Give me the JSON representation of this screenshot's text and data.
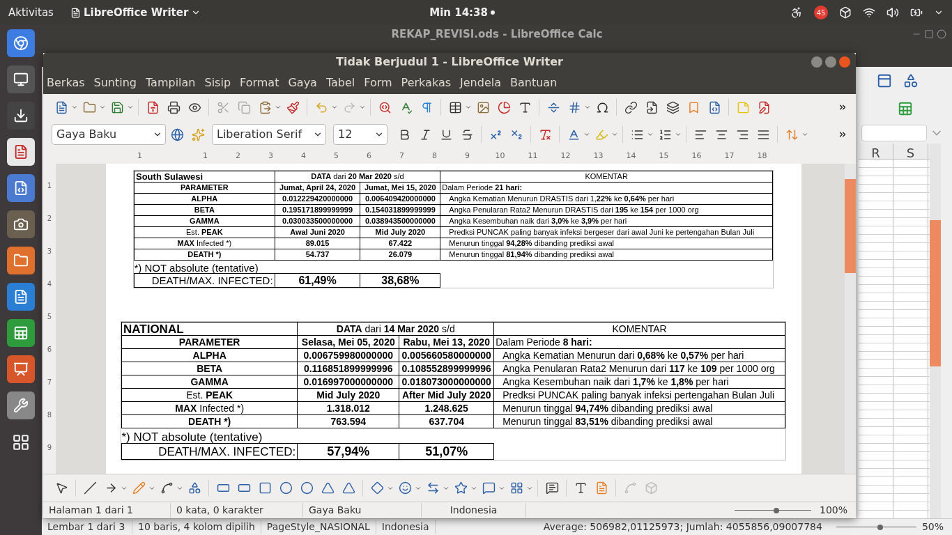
{
  "topbar": {
    "activities": "Aktivitas",
    "app_menu": "LibreOffice Writer",
    "clock": "Min 14:38",
    "notification_badge": "45"
  },
  "calc": {
    "title": "REKAP_REVISI.ods - LibreOffice Calc",
    "columns": [
      "R",
      "S"
    ],
    "status_bar": [
      "Lembar 1 dari 3",
      "10 baris, 4 kolom dipilih",
      "PageStyle_NASIONAL",
      "Indonesia",
      "Average: 506982,01125973; Jumlah: 4055856,09007784",
      "50%"
    ],
    "zoom_slider": {
      "level": 0.55
    }
  },
  "writer": {
    "title": "Tidak Berjudul 1 - LibreOffice Writer",
    "menu": [
      "Berkas",
      "Sunting",
      "Tampilan",
      "Sisip",
      "Format",
      "Gaya",
      "Tabel",
      "Form",
      "Perkakas",
      "Jendela",
      "Bantuan"
    ],
    "style_box": "Gaya Baku",
    "font_box": "Liberation Serif",
    "size_box": "12",
    "ruler_marks": [
      "1",
      "1",
      "2",
      "3",
      "4",
      "5",
      "6",
      "7",
      "8",
      "9",
      "10",
      "11",
      "12",
      "13",
      "14",
      "15",
      "16",
      "17",
      "18"
    ],
    "vertical_ruler_marks": [
      "1",
      "2",
      "3",
      "4",
      "5",
      "6",
      "7",
      "8",
      "9"
    ],
    "tables": [
      {
        "title": "South Sulawesi",
        "data_header": "**DATA** dari **20 Mar 2020** s/d",
        "comment_header": "KOMENTAR",
        "rows": [
          {
            "kind": "header",
            "param": "PARAMETER",
            "v1": "Jumat, April 24, 2020",
            "v2": "Jumat, Mei 15, 2020",
            "comment": "Dalam Periode **21 hari:**"
          },
          {
            "kind": "value",
            "param": "ALPHA",
            "v1": "0.012229420000000",
            "v2": "0.006409420000000",
            "comment": "Angka Kematian Menurun DRASTIS dari 1,**22%** ke **0,64%** per hari"
          },
          {
            "kind": "value",
            "param": "BETA",
            "v1": "0.195171899999999",
            "v2": "0.154031899999999",
            "comment": "Angka Penularan Rata2 Menurun DRASTIS dari **195** ke **154** per 1000 org"
          },
          {
            "kind": "value",
            "param": "GAMMA",
            "v1": "0.030033500000000",
            "v2": "0.038943500000000",
            "comment": "Angka Kesembuhan naik dari **3,0%** ke **3,9%** per hari"
          },
          {
            "kind": "labelled",
            "param": "Est. **PEAK**",
            "v1": "Awal Juni 2020",
            "v2": "Mid July 2020",
            "comment": "Predksi PUNCAK paling banyak infeksi bergeser dari awal Juni ke pertengahan Bulan Juli"
          },
          {
            "kind": "labelled",
            "param": "**MAX** Infected *)",
            "v1": "89.015",
            "v2": "67.422",
            "comment": "Menurun tinggal **94,28%** dibanding prediksi awal"
          },
          {
            "kind": "value",
            "param": "DEATH *)",
            "v1": "54.737",
            "v2": "26.079",
            "comment": "Menurun tinggal **81,94%** dibanding prediksi awal"
          }
        ],
        "note": "*) NOT absolute (tentative)",
        "ratio_label": "DEATH/MAX. INFECTED:",
        "ratio_values": [
          "61,49%",
          "38,68%"
        ]
      },
      {
        "title": "NATIONAL",
        "data_header": "**DATA** dari **14 Mar 2020** s/d",
        "comment_header": "KOMENTAR",
        "rows": [
          {
            "kind": "header",
            "param": "PARAMETER",
            "v1": "Selasa, Mei 05, 2020",
            "v2": "Rabu, Mei 13, 2020",
            "comment": "Dalam Periode **8 hari:**"
          },
          {
            "kind": "value",
            "param": "ALPHA",
            "v1": "0.006759980000000",
            "v2": "0.005660580000000",
            "comment": "Angka Kematian Menurun dari **0,68%** ke **0,57%** per hari"
          },
          {
            "kind": "value",
            "param": "BETA",
            "v1": "0.116851899999996",
            "v2": "0.108552899999996",
            "comment": "Angka Penularan Rata2 Menurun dari **117** ke **109** per 1000 org"
          },
          {
            "kind": "value",
            "param": "GAMMA",
            "v1": "0.016997000000000",
            "v2": "0.018073000000000",
            "comment": "Angka Kesembuhan naik dari **1,7%** ke **1,8%** per hari"
          },
          {
            "kind": "labelled",
            "param": "Est. **PEAK**",
            "v1": "Mid July 2020",
            "v2": "After Mid July 2020",
            "comment": "Predksi PUNCAK paling banyak infeksi pertengahan Bulan Juli"
          },
          {
            "kind": "labelled",
            "param": "**MAX** Infected *)",
            "v1": "1.318.012",
            "v2": "1.248.625",
            "comment": "Menurun tinggal **94,74%** dibanding prediksi awal"
          },
          {
            "kind": "value",
            "param": "DEATH *)",
            "v1": "763.594",
            "v2": "637.704",
            "comment": "Menurun tinggal **83,51%** dibanding prediksi awal"
          }
        ],
        "note": "*) NOT absolute (tentative)",
        "ratio_label": "DEATH/MAX. INFECTED:",
        "ratio_values": [
          "57,94%",
          "51,07%"
        ]
      }
    ],
    "status_bar": [
      "Halaman 1 dari 1",
      "0 kata, 0 karakter",
      "Gaya Baku",
      "Indonesia",
      "100%"
    ],
    "zoom_slider": {
      "level": 0.55
    }
  }
}
